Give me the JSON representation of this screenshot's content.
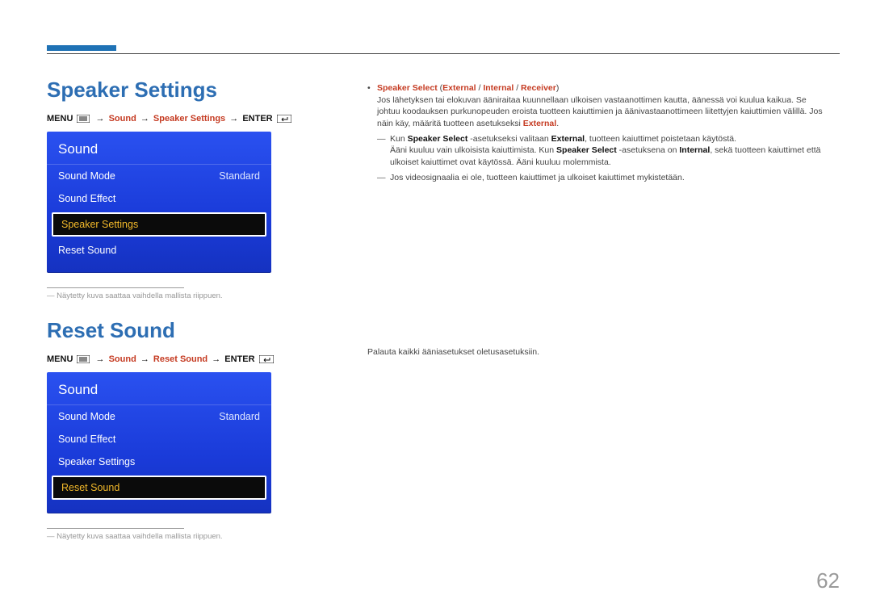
{
  "page_number": "62",
  "section1": {
    "heading": "Speaker Settings",
    "breadcrumb": {
      "menu": "MENU",
      "p1": "Sound",
      "p2": "Speaker Settings",
      "enter": "ENTER"
    },
    "menu": {
      "title": "Sound",
      "items": [
        {
          "label": "Sound Mode",
          "value": "Standard",
          "selected": false
        },
        {
          "label": "Sound Effect",
          "value": "",
          "selected": false
        },
        {
          "label": "Speaker Settings",
          "value": "",
          "selected": true
        },
        {
          "label": "Reset Sound",
          "value": "",
          "selected": false
        }
      ]
    },
    "note": "Näytetty kuva saattaa vaihdella mallista riippuen."
  },
  "section2": {
    "heading": "Reset Sound",
    "breadcrumb": {
      "menu": "MENU",
      "p1": "Sound",
      "p2": "Reset Sound",
      "enter": "ENTER"
    },
    "menu": {
      "title": "Sound",
      "items": [
        {
          "label": "Sound Mode",
          "value": "Standard",
          "selected": false
        },
        {
          "label": "Sound Effect",
          "value": "",
          "selected": false
        },
        {
          "label": "Speaker Settings",
          "value": "",
          "selected": false
        },
        {
          "label": "Reset Sound",
          "value": "",
          "selected": true
        }
      ]
    },
    "note": "Näytetty kuva saattaa vaihdella mallista riippuen."
  },
  "right": {
    "lead_label": "Speaker Select",
    "lead_paren_open": " (",
    "opt1": "External",
    "slash1": " / ",
    "opt2": "Internal",
    "slash2": " / ",
    "opt3": "Receiver",
    "lead_paren_close": ")",
    "para_a": "Jos lähetyksen tai elokuvan ääniraitaa kuunnellaan ulkoisen vastaanottimen kautta, äänessä voi kuulua kaikua. Se johtuu koodauksen purkunopeuden eroista tuotteen kaiuttimien ja äänivastaanottimeen liitettyjen kaiuttimien välillä. Jos näin käy, määritä tuotteen asetukseksi ",
    "para_a_end": "External",
    "para_a_dot": ".",
    "dash1_a": "Kun ",
    "dash1_b": "Speaker Select",
    "dash1_c": " -asetukseksi valitaan ",
    "dash1_d": "External",
    "dash1_e": ", tuotteen kaiuttimet poistetaan käytöstä.",
    "dash1_f": "Ääni kuuluu vain ulkoisista kaiuttimista. Kun ",
    "dash1_g": "Speaker Select",
    "dash1_h": " -asetuksena on ",
    "dash1_i": "Internal",
    "dash1_j": ", sekä tuotteen kaiuttimet että ulkoiset kaiuttimet ovat käytössä. Ääni kuuluu molemmista.",
    "dash2": "Jos videosignaalia ei ole, tuotteen kaiuttimet ja ulkoiset kaiuttimet mykistetään."
  },
  "reset_text": "Palauta kaikki ääniasetukset oletusasetuksiin."
}
